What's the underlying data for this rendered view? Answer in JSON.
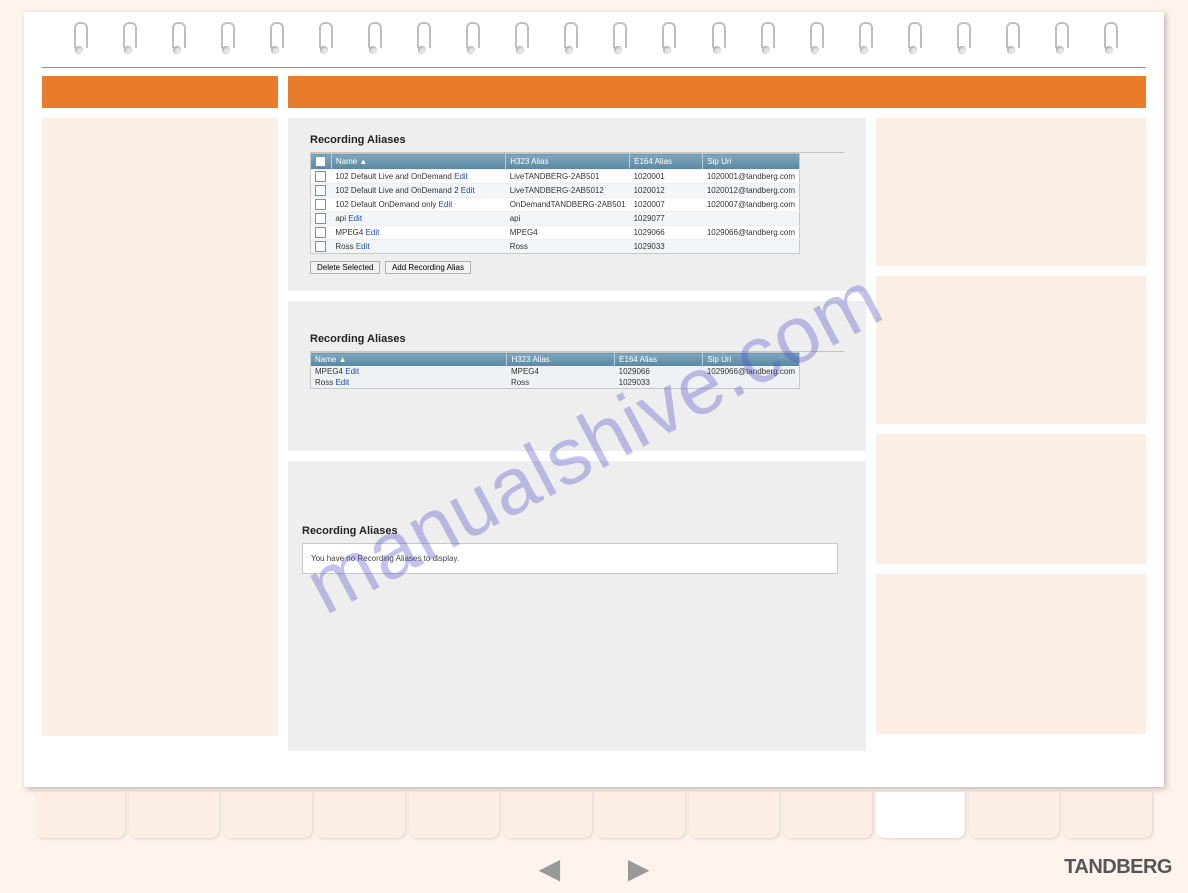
{
  "watermark": "manualshive.com",
  "brand": "TANDBERG",
  "panel1": {
    "heading": "Recording Aliases",
    "cols": [
      "Name ▲",
      "H323 Alias",
      "E164 Alias",
      "Sip Uri"
    ],
    "edit": "Edit",
    "rows": [
      {
        "name": "102 Default Live and OnDemand",
        "h323": "LiveTANDBERG-2AB501",
        "e164": "1020001",
        "sip": "1020001@tandberg.com"
      },
      {
        "name": "102 Default Live and OnDemand 2",
        "h323": "LiveTANDBERG-2AB5012",
        "e164": "1020012",
        "sip": "1020012@tandberg.com"
      },
      {
        "name": "102 Default OnDemand only",
        "h323": "OnDemandTANDBERG-2AB501",
        "e164": "1020007",
        "sip": "1020007@tandberg.com"
      },
      {
        "name": "api",
        "h323": "api",
        "e164": "1029077",
        "sip": ""
      },
      {
        "name": "MPEG4",
        "h323": "MPEG4",
        "e164": "1029066",
        "sip": "1029066@tandberg.com"
      },
      {
        "name": "Ross",
        "h323": "Ross",
        "e164": "1029033",
        "sip": ""
      }
    ],
    "btn_delete": "Delete Selected",
    "btn_add": "Add Recording Alias"
  },
  "panel2": {
    "heading": "Recording Aliases",
    "cols": [
      "Name ▲",
      "H323 Alias",
      "E164 Alias",
      "Sip Uri"
    ],
    "edit": "Edit",
    "rows": [
      {
        "name": "MPEG4",
        "h323": "MPEG4",
        "e164": "1029066",
        "sip": "1029066@tandberg.com"
      },
      {
        "name": "Ross",
        "h323": "Ross",
        "e164": "1029033",
        "sip": ""
      }
    ]
  },
  "panel3": {
    "heading": "Recording Aliases",
    "message": "You have no Recording Aliases to display."
  }
}
